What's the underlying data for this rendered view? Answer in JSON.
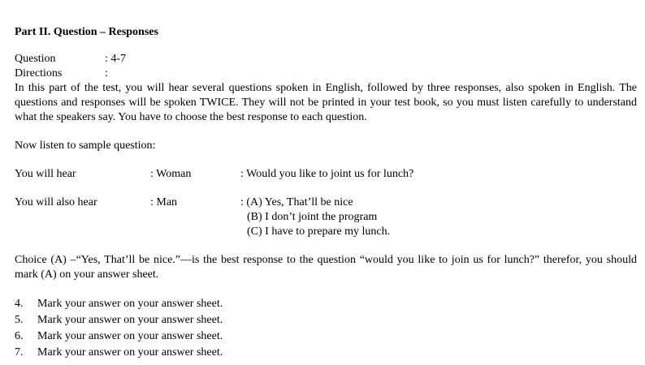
{
  "section_title": "Part II. Question – Responses",
  "meta": {
    "question_label": "Question",
    "question_value": ": 4-7",
    "directions_label": "Directions",
    "directions_value": ":"
  },
  "directions_text": "In this part of the test, you will hear several questions spoken in English, followed by three responses, also spoken in English. The questions and responses will be spoken TWICE. They will not be printed in your test book, so you must listen carefully to understand what the speakers say. You have to choose the best response to each question.",
  "sample_intro": "Now listen to sample question:",
  "sample": {
    "hear1_label": "You will hear",
    "hear1_speaker": ": Woman",
    "hear1_content": ": Would you like to joint us for lunch?",
    "hear2_label": "You will also hear",
    "hear2_speaker": ": Man",
    "choice_a": ": (A) Yes, That’ll be nice",
    "choice_b": "(B) I don’t joint the program",
    "choice_c": "(C) I have to prepare my lunch."
  },
  "explanation": "Choice (A) –“Yes, That’ll be nice.”—is the best response to the question “would you like to join us for lunch?” therefor, you should mark (A) on your answer sheet.",
  "answers": [
    {
      "num": "4.",
      "text": "Mark your answer on your answer sheet."
    },
    {
      "num": "5.",
      "text": "Mark your answer on your answer sheet."
    },
    {
      "num": "6.",
      "text": "Mark your answer on your answer sheet."
    },
    {
      "num": "7.",
      "text": "Mark your answer on your answer sheet."
    }
  ]
}
